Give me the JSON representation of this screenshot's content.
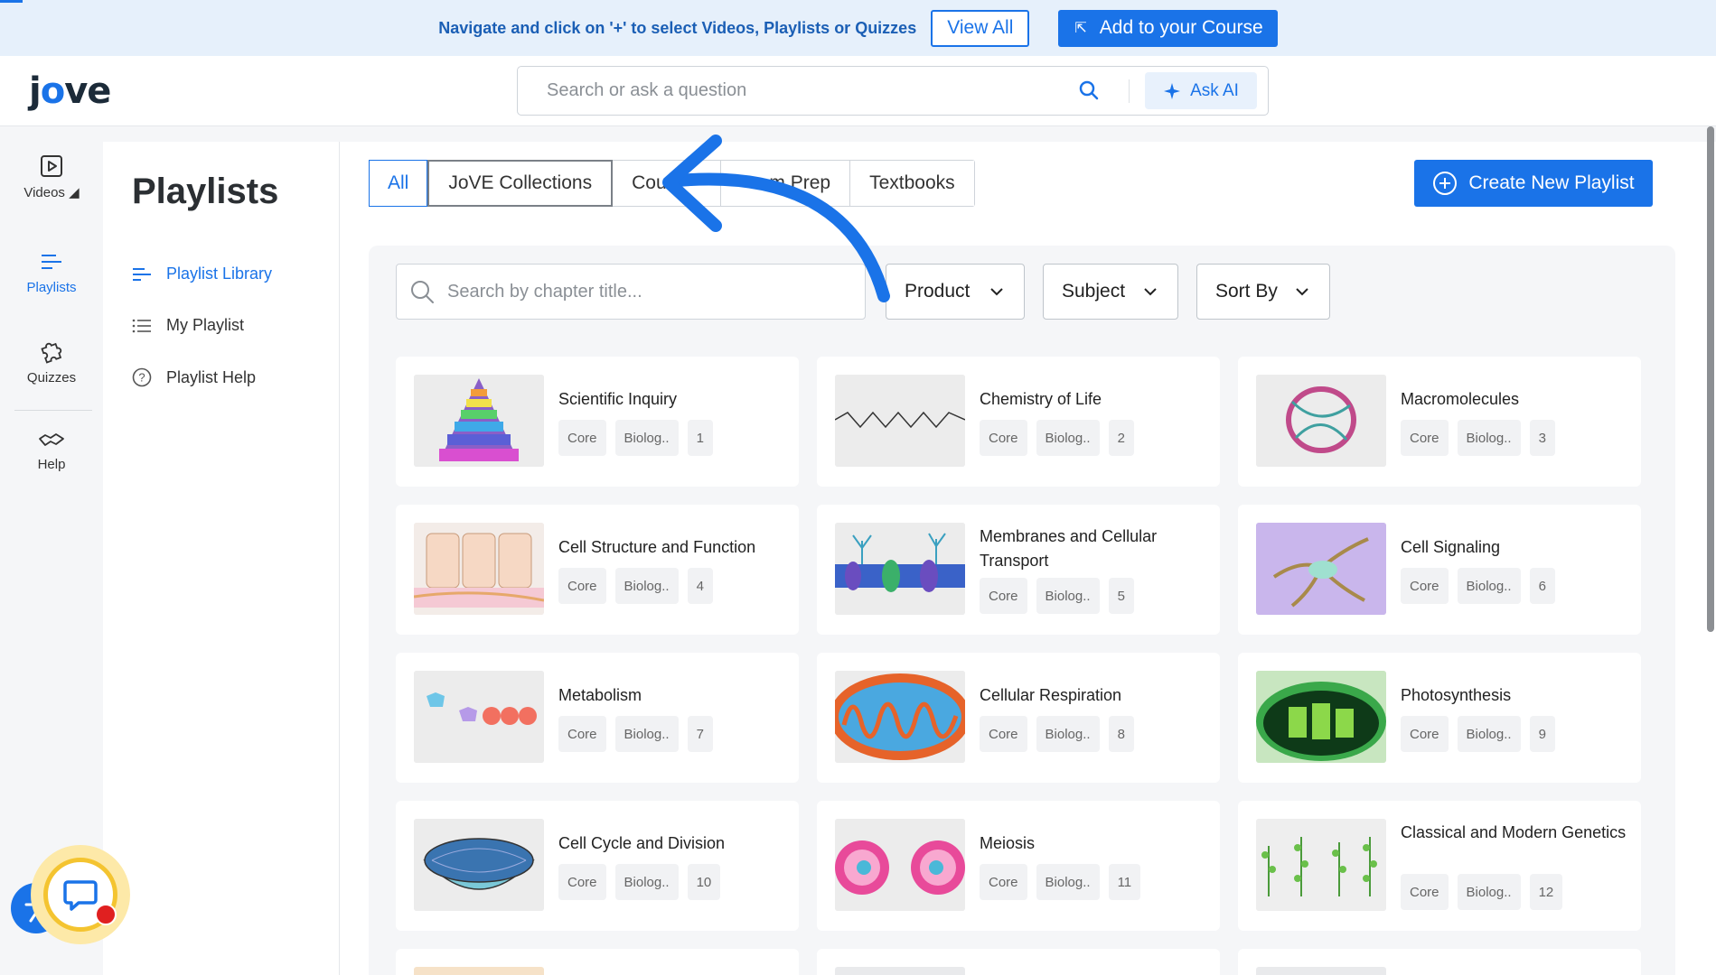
{
  "banner": {
    "text": "Navigate and click on '+' to select Videos, Playlists or Quizzes",
    "view_all": "View All",
    "add_course": "Add to your Course"
  },
  "header": {
    "logo": "jove",
    "search_placeholder": "Search or ask a question",
    "ask_ai": "Ask AI"
  },
  "rail": [
    {
      "label": "Videos",
      "icon": "play-icon"
    },
    {
      "label": "Playlists",
      "icon": "playlist-icon"
    },
    {
      "label": "Quizzes",
      "icon": "puzzle-icon"
    },
    {
      "label": "Help",
      "icon": "handshake-icon"
    }
  ],
  "sidebar": {
    "title": "Playlists",
    "links": [
      {
        "label": "Playlist Library",
        "icon": "playlist-icon"
      },
      {
        "label": "My Playlist",
        "icon": "list-icon"
      },
      {
        "label": "Playlist Help",
        "icon": "help-icon"
      }
    ]
  },
  "tabs": [
    "All",
    "JoVE Collections",
    "Cou",
    "m Prep",
    "Textbooks"
  ],
  "create_playlist": "Create New Playlist",
  "filters": {
    "chapter_search_placeholder": "Search by chapter title...",
    "product": "Product",
    "subject": "Subject",
    "sort_by": "Sort By"
  },
  "cards": [
    {
      "title": "Scientific Inquiry",
      "tag1": "Core",
      "tag2": "Biolog..",
      "num": "1"
    },
    {
      "title": "Chemistry of Life",
      "tag1": "Core",
      "tag2": "Biolog..",
      "num": "2"
    },
    {
      "title": "Macromolecules",
      "tag1": "Core",
      "tag2": "Biolog..",
      "num": "3"
    },
    {
      "title": "Cell Structure and Function",
      "tag1": "Core",
      "tag2": "Biolog..",
      "num": "4"
    },
    {
      "title": "Membranes and Cellular Transport",
      "tag1": "Core",
      "tag2": "Biolog..",
      "num": "5"
    },
    {
      "title": "Cell Signaling",
      "tag1": "Core",
      "tag2": "Biolog..",
      "num": "6"
    },
    {
      "title": "Metabolism",
      "tag1": "Core",
      "tag2": "Biolog..",
      "num": "7"
    },
    {
      "title": "Cellular Respiration",
      "tag1": "Core",
      "tag2": "Biolog..",
      "num": "8"
    },
    {
      "title": "Photosynthesis",
      "tag1": "Core",
      "tag2": "Biolog..",
      "num": "9"
    },
    {
      "title": "Cell Cycle and Division",
      "tag1": "Core",
      "tag2": "Biolog..",
      "num": "10"
    },
    {
      "title": "Meiosis",
      "tag1": "Core",
      "tag2": "Biolog..",
      "num": "11"
    },
    {
      "title": "Classical and Modern Genetics",
      "tag1": "Core",
      "tag2": "Biolog..",
      "num": "12"
    }
  ],
  "colors": {
    "accent": "#1a73e8",
    "banner_bg": "#e6f0fb"
  }
}
